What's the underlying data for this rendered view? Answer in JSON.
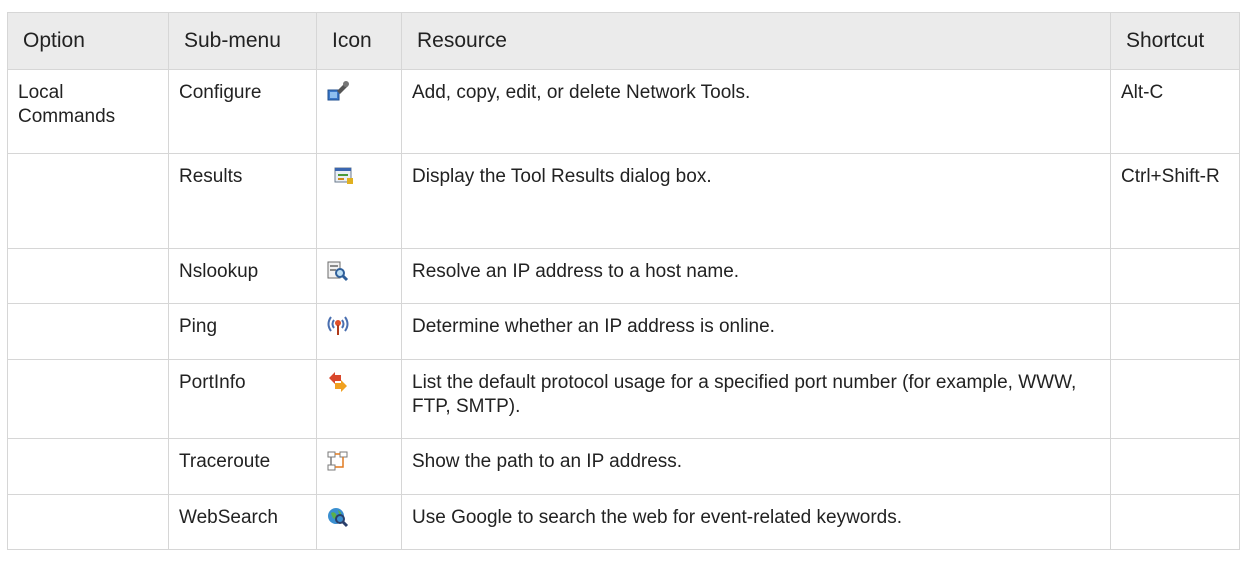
{
  "headers": {
    "option": "Option",
    "submenu": "Sub-menu",
    "icon": "Icon",
    "resource": "Resource",
    "shortcut": "Shortcut"
  },
  "rows": [
    {
      "option": "Local Commands",
      "submenu": "Configure",
      "icon": "configure-wrench-icon",
      "resource": "Add, copy, edit, or delete Network Tools.",
      "shortcut": "Alt-C"
    },
    {
      "option": "",
      "submenu": "Results",
      "icon": "results-window-icon",
      "resource": "Display the Tool Results dialog box.",
      "shortcut": "Ctrl+Shift-R"
    },
    {
      "option": "",
      "submenu": "Nslookup",
      "icon": "nslookup-magnifier-icon",
      "resource": "Resolve an IP address to a host name.",
      "shortcut": ""
    },
    {
      "option": "",
      "submenu": "Ping",
      "icon": "ping-signal-icon",
      "resource": "Determine whether an IP address is online.",
      "shortcut": ""
    },
    {
      "option": "",
      "submenu": "PortInfo",
      "icon": "portinfo-arrows-icon",
      "resource": "List the default protocol usage for a specified port number (for example, WWW, FTP, SMTP).",
      "shortcut": ""
    },
    {
      "option": "",
      "submenu": "Traceroute",
      "icon": "traceroute-path-icon",
      "resource": "Show the path to an IP address.",
      "shortcut": ""
    },
    {
      "option": "",
      "submenu": "WebSearch",
      "icon": "websearch-globe-icon",
      "resource": "Use Google to search the web for event-related keywords.",
      "shortcut": ""
    }
  ]
}
